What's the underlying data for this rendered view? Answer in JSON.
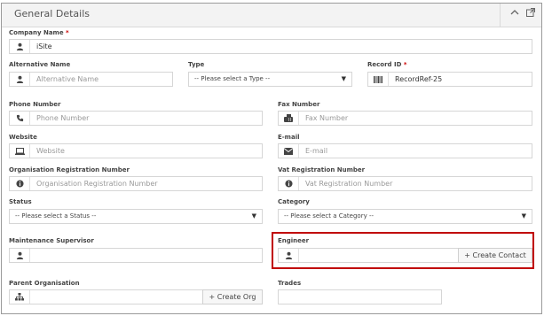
{
  "panel": {
    "title": "General Details",
    "collapse_icon": "chevron-up-icon",
    "external_icon": "external-link-icon"
  },
  "company_name": {
    "label": "Company Name",
    "required_mark": "*",
    "value": "iSite",
    "icon": "user-icon"
  },
  "alternative_name": {
    "label": "Alternative Name",
    "placeholder": "Alternative Name",
    "icon": "user-icon"
  },
  "type": {
    "label": "Type",
    "selected": "-- Please select a Type --"
  },
  "record_id": {
    "label": "Record ID",
    "required_mark": "*",
    "value": "RecordRef-25",
    "icon": "barcode-icon"
  },
  "phone_number": {
    "label": "Phone Number",
    "placeholder": "Phone Number",
    "icon": "phone-icon"
  },
  "fax_number": {
    "label": "Fax Number",
    "placeholder": "Fax Number",
    "icon": "fax-icon"
  },
  "website": {
    "label": "Website",
    "placeholder": "Website",
    "icon": "laptop-icon"
  },
  "email": {
    "label": "E-mail",
    "placeholder": "E-mail",
    "icon": "envelope-icon"
  },
  "org_reg_number": {
    "label": "Organisation Registration Number",
    "placeholder": "Organisation Registration Number",
    "icon": "info-icon"
  },
  "vat_reg_number": {
    "label": "Vat Registration Number",
    "placeholder": "Vat Registration Number",
    "icon": "info-icon"
  },
  "status": {
    "label": "Status",
    "selected": "-- Please select a Status --"
  },
  "category": {
    "label": "Category",
    "selected": "-- Please select a Category --"
  },
  "maintenance_supervisor": {
    "label": "Maintenance Supervisor",
    "icon": "user-icon"
  },
  "engineer": {
    "label": "Engineer",
    "icon": "user-icon",
    "create_contact_label": "+ Create Contact",
    "highlight_color": "#c00000"
  },
  "parent_organisation": {
    "label": "Parent Organisation",
    "icon": "sitemap-icon",
    "create_org_label": "+ Create Org"
  },
  "trades": {
    "label": "Trades"
  }
}
